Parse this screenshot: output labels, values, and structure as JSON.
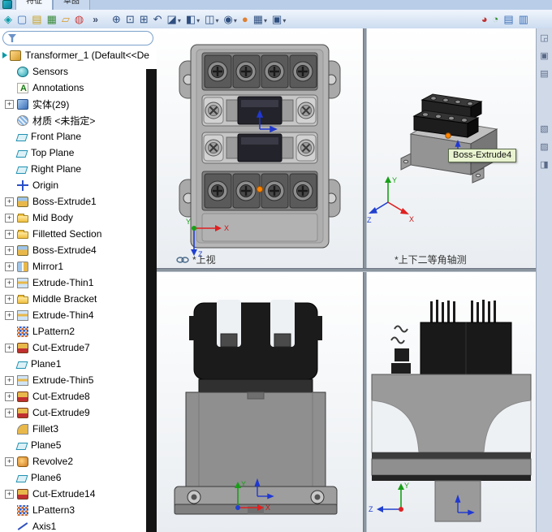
{
  "title_tabs": {
    "features": "特征",
    "sketch": "草图"
  },
  "toolbars": {
    "overflow": "»",
    "left_icons": [
      {
        "name": "app",
        "glyph": "◈",
        "color": "#0a9aa8"
      },
      {
        "name": "new-document",
        "glyph": "▢",
        "color": "#3a6fb8"
      },
      {
        "name": "make-drawing",
        "glyph": "▤",
        "color": "#c8a020"
      },
      {
        "name": "make-assembly",
        "glyph": "▦",
        "color": "#3a8a3a"
      },
      {
        "name": "open",
        "glyph": "▱",
        "color": "#d89a28"
      },
      {
        "name": "web",
        "glyph": "◍",
        "color": "#c84040"
      }
    ],
    "view_icons": [
      {
        "name": "zoom-in",
        "glyph": "⊕"
      },
      {
        "name": "zoom-fit",
        "glyph": "⊡"
      },
      {
        "name": "zoom-area",
        "glyph": "⊞"
      },
      {
        "name": "previous-view",
        "glyph": "↶"
      },
      {
        "name": "section-view",
        "glyph": "◪",
        "dropdown": true
      },
      {
        "name": "view-orientation",
        "glyph": "◧",
        "dropdown": true
      },
      {
        "name": "display-style",
        "glyph": "◫",
        "dropdown": true
      },
      {
        "name": "hide-show-items",
        "glyph": "◉",
        "dropdown": true
      },
      {
        "name": "edit-appearance",
        "glyph": "●",
        "color": "#e08030"
      },
      {
        "name": "apply-scene",
        "glyph": "▦",
        "dropdown": true
      },
      {
        "name": "view-settings",
        "glyph": "▣",
        "dropdown": true
      }
    ],
    "right_icons": [
      {
        "name": "edit-color",
        "glyph": "◕",
        "color": "#c03030"
      },
      {
        "name": "render-preview",
        "glyph": "◔",
        "color": "#2a8a2a"
      },
      {
        "name": "display-options",
        "glyph": "▤",
        "color": "#3a6fb8"
      },
      {
        "name": "screen-capture",
        "glyph": "▥",
        "color": "#3a6fb8"
      }
    ],
    "side_icons": [
      {
        "name": "collapse-pane",
        "glyph": "◲"
      },
      {
        "name": "task-pane-resources",
        "glyph": "▣"
      },
      {
        "name": "task-pane-library",
        "glyph": "▤"
      },
      {
        "name": "task-pane-palette",
        "glyph": "▧"
      },
      {
        "name": "task-pane-appearances",
        "glyph": "▨"
      },
      {
        "name": "task-pane-custom",
        "glyph": "◨"
      }
    ]
  },
  "feature_tree": {
    "root_label": "Transformer_1  (Default<<De",
    "filter_value": "",
    "items": [
      {
        "label": "Sensors",
        "icon": "sensors",
        "expand": false
      },
      {
        "label": "Annotations",
        "icon": "annotations",
        "expand": false
      },
      {
        "label": "实体(29)",
        "icon": "solids",
        "expand": true
      },
      {
        "label": "材质 <未指定>",
        "icon": "material",
        "expand": false
      },
      {
        "label": "Front Plane",
        "icon": "plane",
        "expand": false
      },
      {
        "label": "Top Plane",
        "icon": "plane",
        "expand": false
      },
      {
        "label": "Right Plane",
        "icon": "plane",
        "expand": false
      },
      {
        "label": "Origin",
        "icon": "origin",
        "expand": false
      },
      {
        "label": "Boss-Extrude1",
        "icon": "boss-extrude",
        "expand": true
      },
      {
        "label": "Mid Body",
        "icon": "folder",
        "expand": true
      },
      {
        "label": "Filletted Section",
        "icon": "folder",
        "expand": true
      },
      {
        "label": "Boss-Extrude4",
        "icon": "boss-extrude",
        "expand": true
      },
      {
        "label": "Mirror1",
        "icon": "mirror",
        "expand": true
      },
      {
        "label": "Extrude-Thin1",
        "icon": "thin-extrude",
        "expand": true
      },
      {
        "label": "Middle Bracket",
        "icon": "folder",
        "expand": true
      },
      {
        "label": "Extrude-Thin4",
        "icon": "thin-extrude",
        "expand": true
      },
      {
        "label": "LPattern2",
        "icon": "pattern",
        "expand": false
      },
      {
        "label": "Cut-Extrude7",
        "icon": "cut-extrude",
        "expand": true
      },
      {
        "label": "Plane1",
        "icon": "plane",
        "expand": false
      },
      {
        "label": "Extrude-Thin5",
        "icon": "thin-extrude",
        "expand": true
      },
      {
        "label": "Cut-Extrude8",
        "icon": "cut-extrude",
        "expand": true
      },
      {
        "label": "Cut-Extrude9",
        "icon": "cut-extrude",
        "expand": true
      },
      {
        "label": "Fillet3",
        "icon": "fillet",
        "expand": false
      },
      {
        "label": "Plane5",
        "icon": "plane",
        "expand": false
      },
      {
        "label": "Revolve2",
        "icon": "revolve",
        "expand": true
      },
      {
        "label": "Plane6",
        "icon": "plane",
        "expand": false
      },
      {
        "label": "Cut-Extrude14",
        "icon": "cut-extrude",
        "expand": true
      },
      {
        "label": "LPattern3",
        "icon": "pattern",
        "expand": false
      },
      {
        "label": "Axis1",
        "icon": "axis",
        "expand": false
      }
    ]
  },
  "viewports": {
    "top_left": {
      "label": "*上视"
    },
    "top_right": {
      "label": "*上下二等角轴测",
      "tooltip": "Boss-Extrude4"
    }
  },
  "axis_labels": {
    "x": "X",
    "y": "Y",
    "z": "Z"
  },
  "colors": {
    "origin_marker": "#ff8400",
    "selection_blue": "#2038d0"
  }
}
